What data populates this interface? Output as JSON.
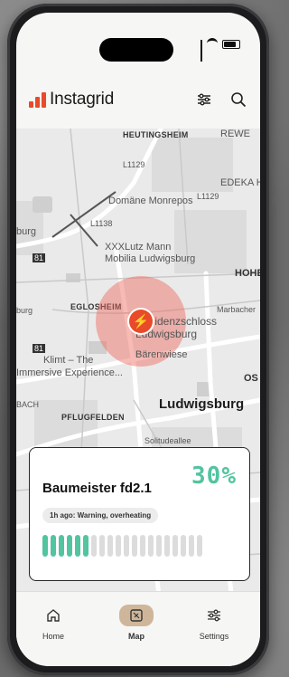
{
  "app": {
    "brand": "Instagrid"
  },
  "header": {
    "filter_icon": "sliders-icon",
    "search_icon": "search-icon"
  },
  "map": {
    "labels": {
      "heutingsheim": "HEUTINGSHEIM",
      "rewe": "REWE",
      "edeka": "EDEKA H",
      "domaene": "Domäne Monrepos",
      "xxxlutz": "XXXLutz Mann",
      "xxxlutz2": "Mobilia Ludwigsburg",
      "eglosheim": "EGLOSHEIM",
      "residenzschloss": "Residenzschloss",
      "residenzschloss2": "Ludwigsburg",
      "klimt": "Klimt – The",
      "immersive": "Immersive Experience...",
      "baerenwiese": "Bärenwiese",
      "ludwigsburg": "Ludwigsburg",
      "pflugfelden": "PFLUGFELDEN",
      "hohe": "HOHE",
      "marbacher": "Marbacher",
      "bach": "BACH",
      "burg1": "burg",
      "burg2": "burg",
      "road81a": "81",
      "road81b": "81",
      "l1129": "L1129",
      "l1138": "L1138",
      "l1129b": "L1129",
      "os": "OS",
      "solitude": "Solitudeallee"
    }
  },
  "device": {
    "name": "Baumeister fd2.1",
    "charge_percent": "30%",
    "charge_level": 0.3,
    "status": "1h ago: Warning, overheating",
    "segments_total": 20,
    "segments_on": 6,
    "accent": "#52c4a0"
  },
  "tabs": [
    {
      "label": "Home",
      "icon": "home-icon"
    },
    {
      "label": "Map",
      "icon": "map-icon"
    },
    {
      "label": "Settings",
      "icon": "settings-sliders-icon"
    }
  ],
  "colors": {
    "brand": "#e84a2a",
    "tab_active_bg": "#cfb69a"
  }
}
